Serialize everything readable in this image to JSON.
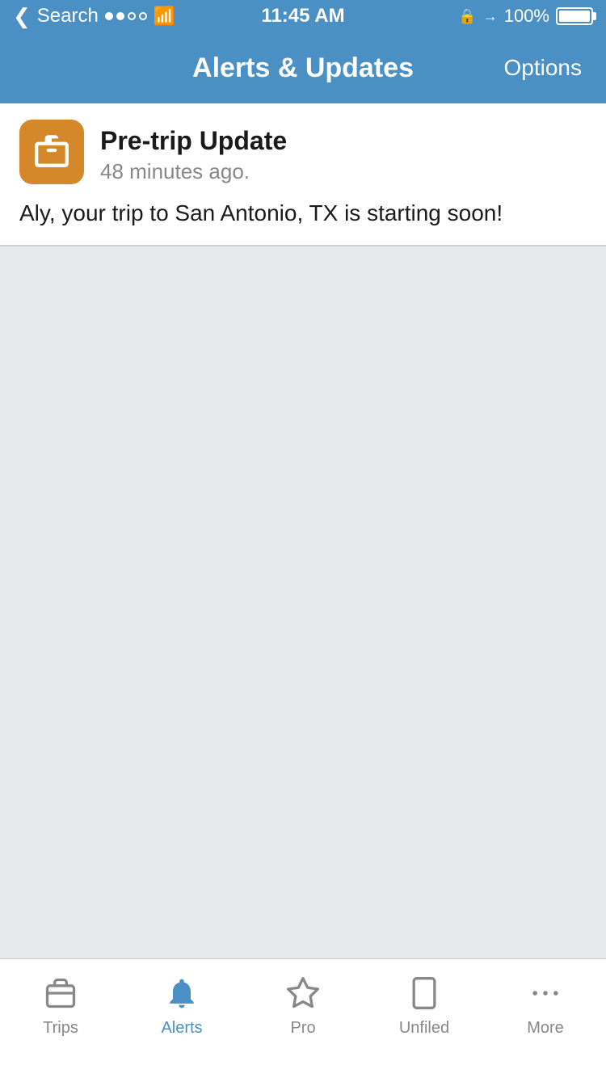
{
  "statusBar": {
    "carrier": "Search",
    "signal": [
      "full",
      "full",
      "empty",
      "empty"
    ],
    "time": "11:45 AM",
    "batteryPercent": "100%",
    "lockIcon": "🔒",
    "locationIcon": "➤"
  },
  "navBar": {
    "title": "Alerts & Updates",
    "optionsLabel": "Options"
  },
  "alerts": [
    {
      "iconType": "suitcase",
      "title": "Pre-trip Update",
      "time": "48 minutes ago.",
      "message": "Aly, your trip to San Antonio, TX is starting soon!"
    }
  ],
  "tabBar": {
    "items": [
      {
        "id": "trips",
        "label": "Trips",
        "icon": "suitcase",
        "active": false
      },
      {
        "id": "alerts",
        "label": "Alerts",
        "icon": "bell",
        "active": true
      },
      {
        "id": "pro",
        "label": "Pro",
        "icon": "star",
        "active": false
      },
      {
        "id": "unfiled",
        "label": "Unfiled",
        "icon": "document",
        "active": false
      },
      {
        "id": "more",
        "label": "More",
        "icon": "dots",
        "active": false
      }
    ]
  },
  "colors": {
    "navBg": "#4a90c4",
    "iconBg": "#d4882a",
    "activeTab": "#4a90c4",
    "inactiveTab": "#888888"
  }
}
